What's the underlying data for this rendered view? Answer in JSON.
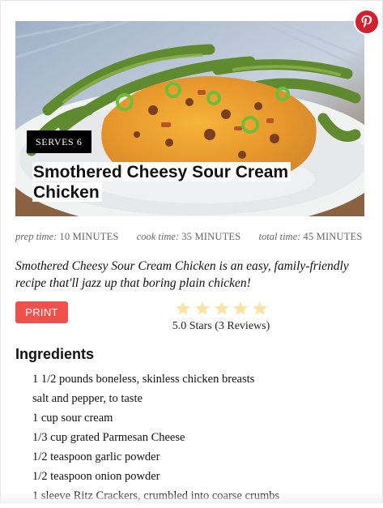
{
  "recipe": {
    "serves": "SERVES 6",
    "title": "Smothered Cheesy Sour Cream Chicken",
    "times": [
      {
        "label": "prep time:",
        "value": "10 MINUTES"
      },
      {
        "label": "cook time:",
        "value": "35 MINUTES"
      },
      {
        "label": "total time:",
        "value": "45 MINUTES"
      }
    ],
    "summary": "Smothered Cheesy Sour Cream Chicken is an easy, family-friendly recipe that'll jazz up that boring plain chicken!",
    "print_label": "PRINT",
    "rating": {
      "value": 5.0,
      "max": 5,
      "text": "5.0 Stars (3 Reviews)",
      "star_color": "#fbe3a6"
    },
    "ingredients_heading": "Ingredients",
    "ingredients": [
      "1 1/2 pounds boneless, skinless chicken breasts",
      "salt and pepper, to taste",
      "1 cup sour cream",
      "1/3 cup grated Parmesan Cheese",
      "1/2 teaspoon garlic powder",
      "1/2 teaspoon onion powder",
      "1 sleeve Ritz Crackers, crumbled into coarse crumbs"
    ]
  },
  "icons": {
    "pin": "pinterest-icon",
    "star": "star-icon"
  },
  "colors": {
    "print_button": "#f0514a",
    "pinterest": "#d4202e",
    "badge": "#000000"
  }
}
